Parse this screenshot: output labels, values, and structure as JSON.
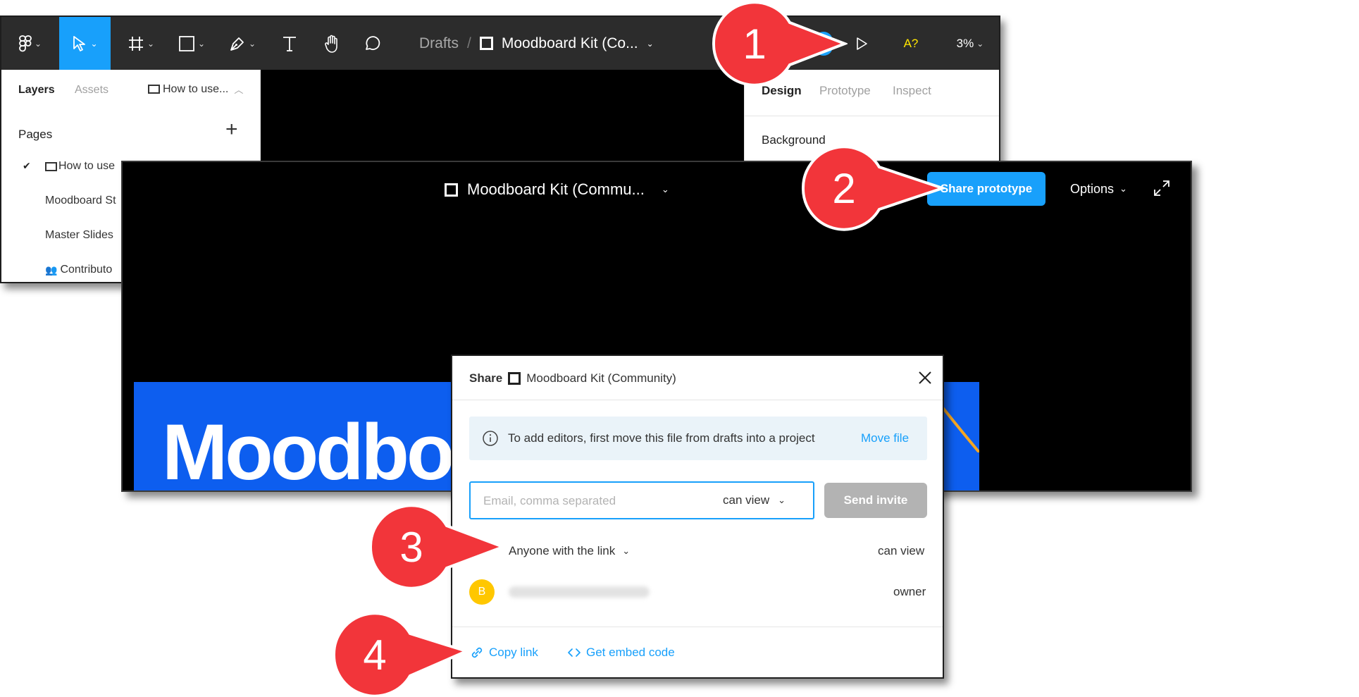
{
  "editor": {
    "toolbar": {
      "breadcrumb_drafts": "Drafts",
      "breadcrumb_sep": "/",
      "file_name": "Moodboard Kit (Co...",
      "font_warning": "A?",
      "zoom": "3%"
    },
    "left_panel": {
      "tab_layers": "Layers",
      "tab_assets": "Assets",
      "current_page": "How to use...",
      "pages_header": "Pages",
      "pages": [
        {
          "label": "How to use",
          "checked": true
        },
        {
          "label": "Moodboard St"
        },
        {
          "label": "Master Slides"
        },
        {
          "label": "Contributo"
        }
      ]
    },
    "right_panel": {
      "tab_design": "Design",
      "tab_prototype": "Prototype",
      "tab_inspect": "Inspect",
      "section_background": "Background"
    }
  },
  "viewer": {
    "title": "Moodboard Kit (Commu...",
    "share_button": "Share prototype",
    "options_label": "Options",
    "frame_text": "Moodboa"
  },
  "share_dialog": {
    "title_prefix": "Share",
    "file_name": "Moodboard Kit (Community)",
    "info_text": "To add editors, first move this file from drafts into a project",
    "move_file_link": "Move file",
    "email_placeholder": "Email, comma separated",
    "permission": "can view",
    "send_invite": "Send invite",
    "link_access": "Anyone with the link",
    "link_permission": "can view",
    "owner_initial": "B",
    "owner_role": "owner",
    "copy_link": "Copy link",
    "embed_code": "Get embed code"
  },
  "callouts": [
    "1",
    "2",
    "3",
    "4"
  ],
  "colors": {
    "accent": "#18a0fb",
    "toolbar": "#2c2c2c",
    "callout": "#f2353a",
    "frame_blue": "#0d5eef",
    "avatar": "#ffc700",
    "font_warning": "#ffe600"
  }
}
